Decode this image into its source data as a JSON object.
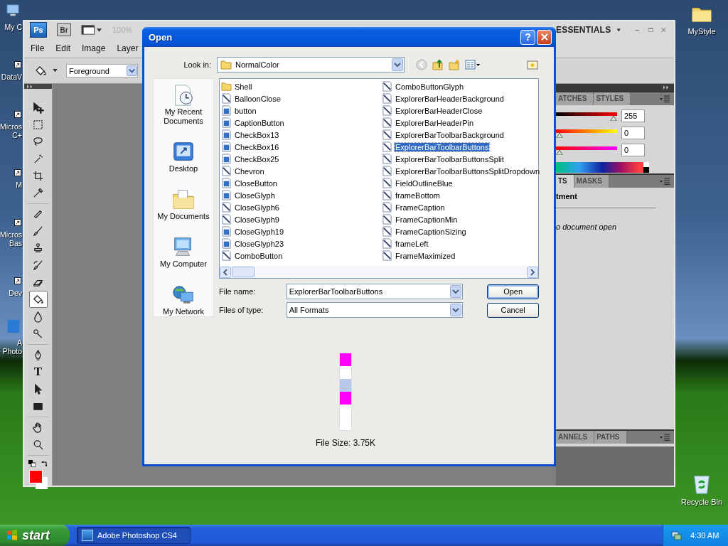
{
  "desktop_left": [
    {
      "kind": "computer",
      "lines": [
        "My C"
      ]
    },
    {
      "kind": "shortcut",
      "lines": [
        "DataV"
      ]
    },
    {
      "kind": "shortcut",
      "lines": [
        "Micros",
        "C+"
      ]
    },
    {
      "kind": "shortcut",
      "lines": [
        "M"
      ]
    },
    {
      "kind": "shortcut",
      "lines": [
        "Micros",
        "Bas"
      ]
    },
    {
      "kind": "shortcut",
      "lines": [
        "Dev"
      ]
    },
    {
      "kind": "app",
      "lines": [
        "A",
        "Photo"
      ]
    }
  ],
  "desktop_right": [
    {
      "kind": "folder",
      "label": "MyStyle"
    },
    {
      "kind": "recycle",
      "label": "Recycle Bin"
    }
  ],
  "photoshop": {
    "app_bar": {
      "logo": "Ps",
      "bridge": "Br",
      "zoom": {
        "text": "100%",
        "disabled": true
      },
      "workspace": "ESSENTIALS"
    },
    "menu": [
      "File",
      "Edit",
      "Image",
      "Layer"
    ],
    "options": {
      "fill_source": "Foreground"
    },
    "tool_groups": [
      [
        {
          "kind": "move",
          "selected": false
        },
        {
          "kind": "marquee",
          "selected": false
        },
        {
          "kind": "lasso",
          "selected": false
        },
        {
          "kind": "wand",
          "selected": false
        },
        {
          "kind": "crop",
          "selected": false
        },
        {
          "kind": "eyedropper",
          "selected": false
        }
      ],
      [
        {
          "kind": "healing",
          "selected": false
        },
        {
          "kind": "brush",
          "selected": false
        },
        {
          "kind": "stamp",
          "selected": false
        },
        {
          "kind": "history",
          "selected": false
        },
        {
          "kind": "eraser",
          "selected": false
        },
        {
          "kind": "bucket",
          "selected": true
        },
        {
          "kind": "blur",
          "selected": false
        },
        {
          "kind": "dodge",
          "selected": false
        }
      ],
      [
        {
          "kind": "pen",
          "selected": false
        },
        {
          "kind": "type",
          "glyph": "T",
          "selected": false
        },
        {
          "kind": "path",
          "selected": false
        },
        {
          "kind": "shape",
          "selected": false
        }
      ],
      [
        {
          "kind": "hand",
          "selected": false
        },
        {
          "kind": "zoom",
          "selected": false
        }
      ]
    ],
    "color_panel": {
      "tabs": [
        {
          "label": "ATCHES",
          "selected": false
        },
        {
          "label": "STYLES",
          "selected": false
        }
      ],
      "sliders": [
        {
          "kind": "red",
          "level": 1,
          "reading": "255"
        },
        {
          "kind": "green",
          "level": 0,
          "reading": "0"
        },
        {
          "kind": "blue",
          "level": 0,
          "reading": "0"
        }
      ]
    },
    "adjustments_panel": {
      "tabs": [
        {
          "label": "TS",
          "selected": true
        },
        {
          "label": "MASKS",
          "selected": false
        }
      ],
      "heading": "tment",
      "message": "o document open"
    },
    "channels_panel": {
      "tabs": [
        {
          "label": "ANNELS",
          "selected": false
        },
        {
          "label": "PATHS",
          "selected": false
        }
      ]
    }
  },
  "dialog": {
    "title": "Open",
    "help": "?",
    "look_in": {
      "label": "Look in:",
      "value": "NormalColor"
    },
    "places": [
      {
        "kind": "recent",
        "label": "My Recent Documents"
      },
      {
        "kind": "desktop",
        "label": "Desktop"
      },
      {
        "kind": "documents",
        "label": "My Documents"
      },
      {
        "kind": "computer",
        "label": "My Computer"
      },
      {
        "kind": "network",
        "label": "My Network"
      }
    ],
    "files": [
      {
        "kind": "folder",
        "name": "Shell",
        "selected": false
      },
      {
        "kind": "paint",
        "name": "BalloonClose",
        "selected": false
      },
      {
        "kind": "picture",
        "name": "button",
        "selected": false
      },
      {
        "kind": "picture",
        "name": "CaptionButton",
        "selected": false
      },
      {
        "kind": "picture",
        "name": "CheckBox13",
        "selected": false
      },
      {
        "kind": "picture",
        "name": "CheckBox16",
        "selected": false
      },
      {
        "kind": "picture",
        "name": "CheckBox25",
        "selected": false
      },
      {
        "kind": "paint",
        "name": "Chevron",
        "selected": false
      },
      {
        "kind": "picture",
        "name": "CloseButton",
        "selected": false
      },
      {
        "kind": "picture",
        "name": "CloseGlyph",
        "selected": false
      },
      {
        "kind": "paint",
        "name": "CloseGlyph6",
        "selected": false
      },
      {
        "kind": "paint",
        "name": "CloseGlyph9",
        "selected": false
      },
      {
        "kind": "picture",
        "name": "CloseGlyph19",
        "selected": false
      },
      {
        "kind": "picture",
        "name": "CloseGlyph23",
        "selected": false
      },
      {
        "kind": "paint",
        "name": "ComboButton",
        "selected": false
      },
      {
        "kind": "paint",
        "name": "ComboButtonGlyph",
        "selected": false
      },
      {
        "kind": "paint",
        "name": "ExplorerBarHeaderBackground",
        "selected": false
      },
      {
        "kind": "paint",
        "name": "ExplorerBarHeaderClose",
        "selected": false
      },
      {
        "kind": "paint",
        "name": "ExplorerBarHeaderPin",
        "selected": false
      },
      {
        "kind": "paint",
        "name": "ExplorerBarToolbarBackground",
        "selected": false
      },
      {
        "kind": "paint",
        "name": "ExplorerBarToolbarButtons",
        "selected": true
      },
      {
        "kind": "paint",
        "name": "ExplorerBarToolbarButtonsSplit",
        "selected": false
      },
      {
        "kind": "paint",
        "name": "ExplorerBarToolbarButtonsSplitDropdown",
        "selected": false
      },
      {
        "kind": "paint",
        "name": "FieldOutlineBlue",
        "selected": false
      },
      {
        "kind": "paint",
        "name": "frameBottom",
        "selected": false
      },
      {
        "kind": "paint",
        "name": "FrameCaption",
        "selected": false
      },
      {
        "kind": "paint",
        "name": "FrameCaptionMin",
        "selected": false
      },
      {
        "kind": "paint",
        "name": "FrameCaptionSizing",
        "selected": false
      },
      {
        "kind": "paint",
        "name": "frameLeft",
        "selected": false
      },
      {
        "kind": "paint",
        "name": "FrameMaximized",
        "selected": false
      }
    ],
    "file_name": {
      "label": "File name:",
      "value": "ExplorerBarToolbarButtons"
    },
    "file_type": {
      "label": "Files of type:",
      "value": "All Formats"
    },
    "buttons": [
      {
        "label": "Open",
        "default": true
      },
      {
        "label": "Cancel",
        "default": false
      }
    ],
    "file_size": "File Size: 3.75K"
  },
  "taskbar": {
    "start": "start",
    "tasks": [
      {
        "label": "Adobe Photoshop CS4",
        "selected": true
      }
    ],
    "clock": "4:30 AM"
  }
}
